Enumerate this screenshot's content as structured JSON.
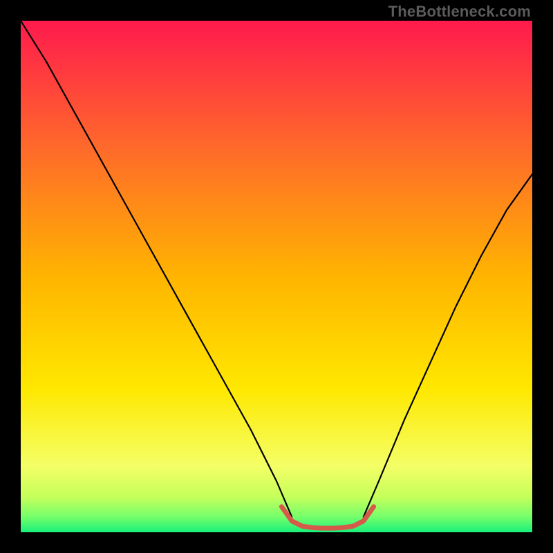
{
  "watermark": "TheBottleneck.com",
  "chart_data": {
    "type": "line",
    "title": "",
    "xlabel": "",
    "ylabel": "",
    "xlim": [
      0,
      100
    ],
    "ylim": [
      0,
      100
    ],
    "gradient_stops": [
      {
        "pos": 0.0,
        "color": "#ff1a4d"
      },
      {
        "pos": 0.25,
        "color": "#ff6a2a"
      },
      {
        "pos": 0.5,
        "color": "#ffb400"
      },
      {
        "pos": 0.72,
        "color": "#ffe800"
      },
      {
        "pos": 0.87,
        "color": "#f4ff66"
      },
      {
        "pos": 0.93,
        "color": "#c6ff5a"
      },
      {
        "pos": 0.97,
        "color": "#75ff6b"
      },
      {
        "pos": 1.0,
        "color": "#18f07a"
      }
    ],
    "series": [
      {
        "name": "left-branch",
        "color": "#000000",
        "width": 2.2,
        "x": [
          0,
          5,
          10,
          15,
          20,
          25,
          30,
          35,
          40,
          45,
          50,
          53
        ],
        "y": [
          100,
          92,
          83,
          74,
          65,
          56,
          47,
          38,
          29,
          20,
          10,
          3
        ]
      },
      {
        "name": "right-branch",
        "color": "#000000",
        "width": 2.2,
        "x": [
          67,
          70,
          75,
          80,
          85,
          90,
          95,
          100
        ],
        "y": [
          3,
          10,
          22,
          33,
          44,
          54,
          63,
          70
        ]
      },
      {
        "name": "valley-highlight",
        "color": "#d65a4a",
        "width": 7,
        "x": [
          51,
          53,
          55,
          57,
          59,
          61,
          63,
          65,
          67,
          69
        ],
        "y": [
          5.0,
          2.2,
          1.2,
          0.9,
          0.8,
          0.8,
          0.9,
          1.2,
          2.2,
          5.0
        ]
      }
    ]
  }
}
